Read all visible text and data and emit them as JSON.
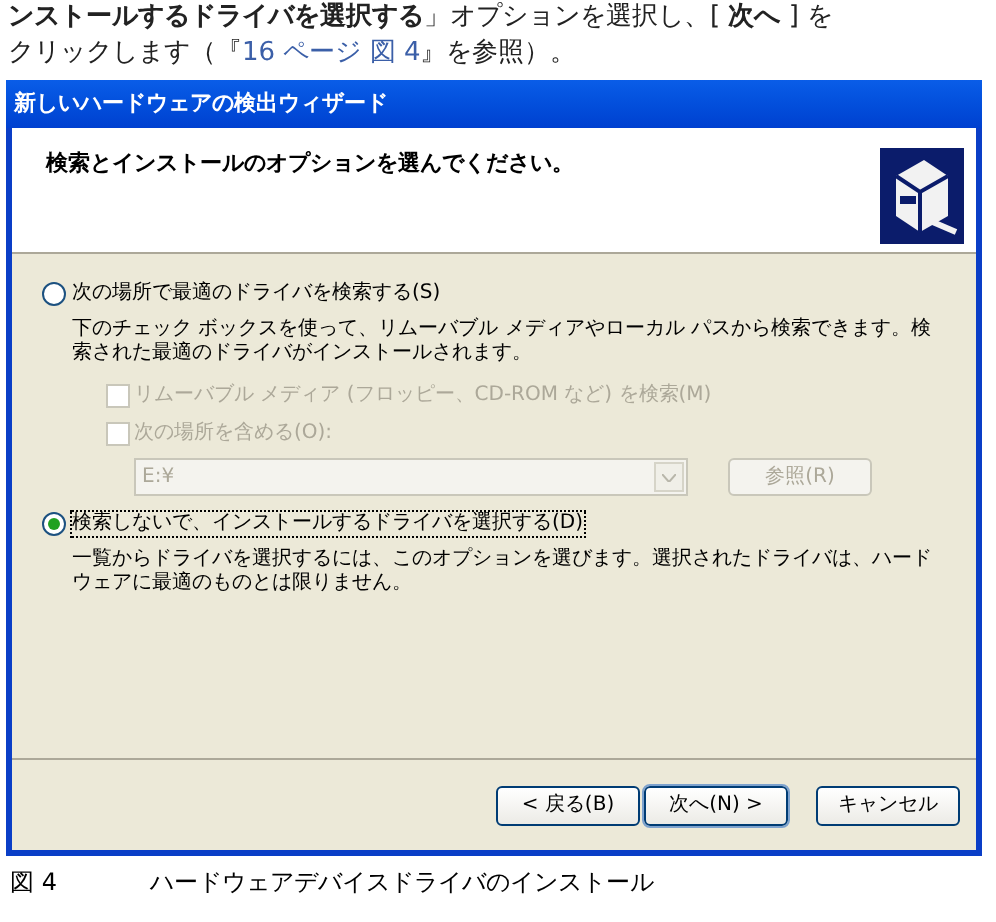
{
  "document": {
    "lines": [
      "**ンストールするドライバを選択する**」オプションを選択し、[ **次へ** ] を"
    ],
    "reference": {
      "before": "クリックします（『",
      "link": "16 ページ 図 4",
      "after": "』を参照）。"
    }
  },
  "dialog": {
    "title": "新しいハードウェアの検出ウィザード",
    "heading": "検索とインストールのオプションを選んでください。",
    "options": [
      {
        "label": "次の場所で最適のドライバを検索する(S)",
        "selected": false,
        "description": "下のチェック ボックスを使って、リムーバブル メディアやローカル パスから検索できます。検索された最適のドライバがインストールされます。",
        "checkboxes": [
          {
            "label": "リムーバブル メディア (フロッピー、CD-ROM など) を検索(M)",
            "checked": false,
            "disabled": true
          },
          {
            "label": "次の場所を含める(O):",
            "checked": false,
            "disabled": true
          }
        ],
        "path": {
          "value": "E:¥",
          "disabled": true
        },
        "browse": {
          "label": "参照(R)",
          "disabled": true
        }
      },
      {
        "label": "検索しないで、インストールするドライバを選択する(D)",
        "selected": true,
        "description": "一覧からドライバを選択するには、このオプションを選びます。選択されたドライバは、ハードウェアに最適のものとは限りません。"
      }
    ],
    "buttons": [
      "< 戻る(B)",
      "次へ(N) >",
      "キャンセル"
    ]
  },
  "caption": {
    "number": "図 4",
    "text": "ハードウェアデバイスドライバのインストール"
  }
}
